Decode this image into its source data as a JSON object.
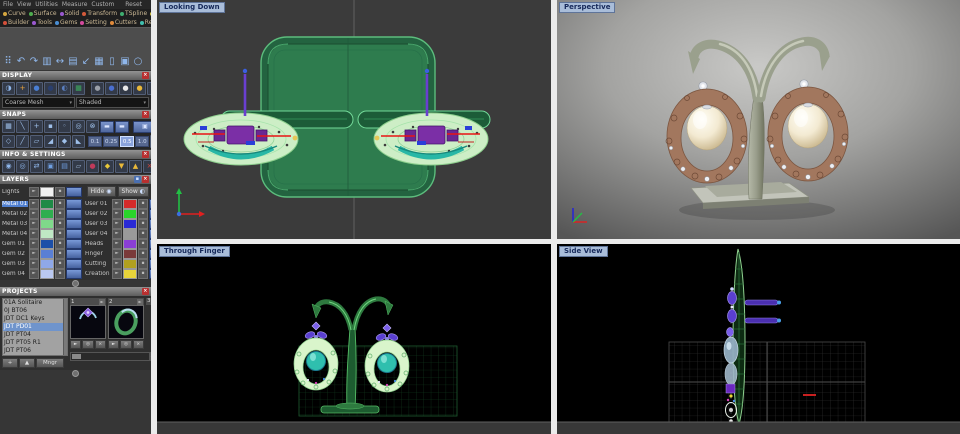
{
  "menu_bar": {
    "items": [
      "File",
      "View",
      "Utilities",
      "Measure",
      "Custom"
    ],
    "reset_label": "Reset"
  },
  "ribbon": {
    "row1": [
      {
        "label": "Curve",
        "bullet": "#d4a63f"
      },
      {
        "label": "Surface",
        "bullet": "#4fae4f"
      },
      {
        "label": "Solid",
        "bullet": "#9b59d0"
      },
      {
        "label": "Transform",
        "bullet": "#d45a3a"
      },
      {
        "label": "TSpline",
        "bullet": "#3fae6f"
      },
      {
        "label": "Art",
        "bullet": "#d4c43f"
      }
    ],
    "row2": [
      {
        "label": "Builder",
        "bullet": "#d4503a"
      },
      {
        "label": "Tools",
        "bullet": "#9b59d0"
      },
      {
        "label": "Gems",
        "bullet": "#4a8fd4"
      },
      {
        "label": "Setting",
        "bullet": "#d44a9e"
      },
      {
        "label": "Cutters",
        "bullet": "#e08a3a"
      },
      {
        "label": "Render",
        "bullet": "#3fbfae"
      }
    ]
  },
  "main_toolbar": {
    "icons": [
      {
        "n": "selection-dots-icon",
        "g": "⠿"
      },
      {
        "n": "undo-icon",
        "g": "↶"
      },
      {
        "n": "redo-icon",
        "g": "↷"
      },
      {
        "n": "sort-bars-icon",
        "g": "▥"
      },
      {
        "n": "pan-icon",
        "g": "↔"
      },
      {
        "n": "new-page-icon",
        "g": "▤"
      },
      {
        "n": "import-arrow-icon",
        "g": "↙"
      },
      {
        "n": "zoom-window-icon",
        "g": "▦"
      },
      {
        "n": "split-view-icon",
        "g": "▯"
      },
      {
        "n": "sheet-icon",
        "g": "▣"
      },
      {
        "n": "circle-select-icon",
        "g": "○"
      }
    ]
  },
  "panels": {
    "display": {
      "title": "DISPLAY",
      "close_glyph": "×",
      "icons_left": [
        {
          "n": "clock-display-icon",
          "g": "◑",
          "c": "#8fb6ea"
        },
        {
          "n": "add-display-icon",
          "g": "+",
          "c": "#e8a33d"
        },
        {
          "n": "shaded-sphere-icon",
          "g": "●",
          "c": "#4a7fd4"
        },
        {
          "n": "dark-sphere-icon",
          "g": "●",
          "c": "#2a3f6e"
        },
        {
          "n": "swirl-sphere-icon",
          "g": "◐",
          "c": "#5a7fc0"
        },
        {
          "n": "grid-display-icon",
          "g": "▦",
          "c": "#3fae5f"
        }
      ],
      "icons_right": [
        {
          "n": "ghost-sphere-icon",
          "g": "●",
          "c": "#9a9fa8"
        },
        {
          "n": "blue-sphere-icon",
          "g": "●",
          "c": "#4a6fd0"
        },
        {
          "n": "white-sphere-icon",
          "g": "●",
          "c": "#e8e8e8"
        },
        {
          "n": "gold-sphere-icon",
          "g": "●",
          "c": "#e8b83a"
        },
        {
          "n": "box-display-icon",
          "g": "▪",
          "c": "#3a4150"
        }
      ],
      "mesh_dropdown": "Coarse Mesh",
      "shade_dropdown": "Shaded"
    },
    "snaps": {
      "title": "SNAPS",
      "close_glyph": "×",
      "row1_icons": [
        {
          "n": "grid-snap-icon",
          "g": "▦"
        },
        {
          "n": "near-snap-icon",
          "g": "╲"
        },
        {
          "n": "point-snap-icon",
          "g": "+"
        },
        {
          "n": "mid-snap-icon",
          "g": "▪"
        },
        {
          "n": "end-snap-icon",
          "g": "◦"
        },
        {
          "n": "center-snap-icon",
          "g": "◎"
        },
        {
          "n": "intersection-snap-icon",
          "g": "⊗"
        }
      ],
      "row1_buttons": [
        {
          "n": "ortho-toggle-button",
          "g": "▬"
        },
        {
          "n": "planar-toggle-button",
          "g": "▬"
        }
      ],
      "row1_wide_button": {
        "n": "osnap-toggle-button",
        "g": "▣"
      },
      "row2_icons": [
        {
          "n": "quad-snap-icon",
          "g": "◇"
        },
        {
          "n": "tangent-snap-icon",
          "g": "╱"
        },
        {
          "n": "pen-snap-icon",
          "g": "▱"
        },
        {
          "n": "project-snap-icon",
          "g": "◢"
        },
        {
          "n": "surface-snap-icon",
          "g": "◆"
        },
        {
          "n": "track-snap-icon",
          "g": "◣"
        }
      ],
      "increments": [
        "0.1",
        "0.25",
        "0.5",
        "1.0"
      ],
      "selected_increment": "0.5",
      "row2_end_icon": {
        "n": "gumball-icon",
        "g": "◈"
      }
    },
    "info_settings": {
      "title": "INFO & SETTINGS",
      "close_glyph": "×",
      "icons_left": [
        {
          "n": "select-info-icon",
          "g": "◉",
          "c": "#8fb6ea"
        },
        {
          "n": "measure-info-icon",
          "g": "◎",
          "c": "#8fb6ea"
        },
        {
          "n": "swap-icon",
          "g": "⇄",
          "c": "#8fb6ea"
        },
        {
          "n": "cube-info-icon",
          "g": "▣",
          "c": "#6f9fe0"
        },
        {
          "n": "page-info-icon",
          "g": "▤",
          "c": "#6f9fe0"
        },
        {
          "n": "notes-icon",
          "g": "▱",
          "c": "#9fb6d4"
        },
        {
          "n": "material-ball-icon",
          "g": "●",
          "c": "#c03a5a"
        }
      ],
      "icons_right": [
        {
          "n": "gem-weight-icon",
          "g": "◆",
          "c": "#e8c83a"
        },
        {
          "n": "export-settings-icon",
          "g": "▼",
          "c": "#e8b83a"
        },
        {
          "n": "import-settings-icon",
          "g": "▲",
          "c": "#e8b83a"
        },
        {
          "n": "purge-icon",
          "g": "×",
          "c": "#d4483a"
        }
      ]
    },
    "layers": {
      "title": "LAYERS",
      "min_glyph": "▪",
      "close_glyph": "×",
      "row_glyphs": {
        "expand": "►",
        "lock": "▪"
      },
      "lights": {
        "name": "Lights",
        "color": "#f2f2f2"
      },
      "hide_button": {
        "label": "Hide",
        "glyph": "◉"
      },
      "show_button": {
        "label": "Show",
        "glyph": "◐"
      },
      "left": [
        {
          "name": "Metal 01",
          "color": "#1e8a46",
          "selected": true
        },
        {
          "name": "Metal 02",
          "color": "#2fae4f",
          "selected": false
        },
        {
          "name": "Metal 03",
          "color": "#7fd98a",
          "selected": false
        },
        {
          "name": "Metal 04",
          "color": "#bfe8c4",
          "selected": false
        },
        {
          "name": "Gem 01",
          "color": "#1d4fa8",
          "selected": false
        },
        {
          "name": "Gem 02",
          "color": "#5a7fd4",
          "selected": false
        },
        {
          "name": "Gem 03",
          "color": "#8fa8e8",
          "selected": false
        },
        {
          "name": "Gem 04",
          "color": "#bac8f0",
          "selected": false
        }
      ],
      "right": [
        {
          "name": "User 01",
          "color": "#d42a2a",
          "selected": false
        },
        {
          "name": "User 02",
          "color": "#2ad42a",
          "selected": false
        },
        {
          "name": "User 03",
          "color": "#2a2ad4",
          "selected": false
        },
        {
          "name": "User 04",
          "color": "#9a9a9a",
          "selected": false
        },
        {
          "name": "Heads",
          "color": "#8a3fd4",
          "selected": false
        },
        {
          "name": "Finger",
          "color": "#7a3a3a",
          "selected": false
        },
        {
          "name": "Cutting",
          "color": "#b0a020",
          "selected": false
        },
        {
          "name": "Creation",
          "color": "#e8d43a",
          "selected": false
        }
      ]
    },
    "projects": {
      "title": "PROJECTS",
      "close_glyph": "×",
      "items": [
        "01A Solitaire",
        "0J BT06",
        "JDT DC1 Keys",
        "JDT PD01",
        "JDT PT04",
        "JDT PT05 R1",
        "JDT PT06"
      ],
      "selected_item": "JDT PD01",
      "slots": [
        "1",
        "2",
        "3"
      ],
      "thumb_buttons": [
        {
          "n": "apply-project-button",
          "g": "►"
        },
        {
          "n": "preview-project-button",
          "g": "◎"
        },
        {
          "n": "delete-project-button",
          "g": "×"
        }
      ],
      "bottom_buttons": [
        {
          "n": "add-project-button",
          "g": "+"
        },
        {
          "n": "promote-project-button",
          "g": "▲"
        },
        {
          "n": "manager-button",
          "g": "Mngr"
        }
      ]
    }
  },
  "viewports": {
    "looking_down": {
      "label": "Looking Down"
    },
    "perspective": {
      "label": "Perspective"
    },
    "through_finger": {
      "label": "Through Finger"
    },
    "side_view": {
      "label": "Side View"
    }
  },
  "colors": {
    "selection_blue": "#4f7fd0",
    "viewport_label_bg": "#a9bdd9",
    "accent_red": "#b83030",
    "wireframe_green": "#58b878",
    "pearl_teal": "#2fbfae",
    "purple_accent": "#6a3fd0"
  }
}
